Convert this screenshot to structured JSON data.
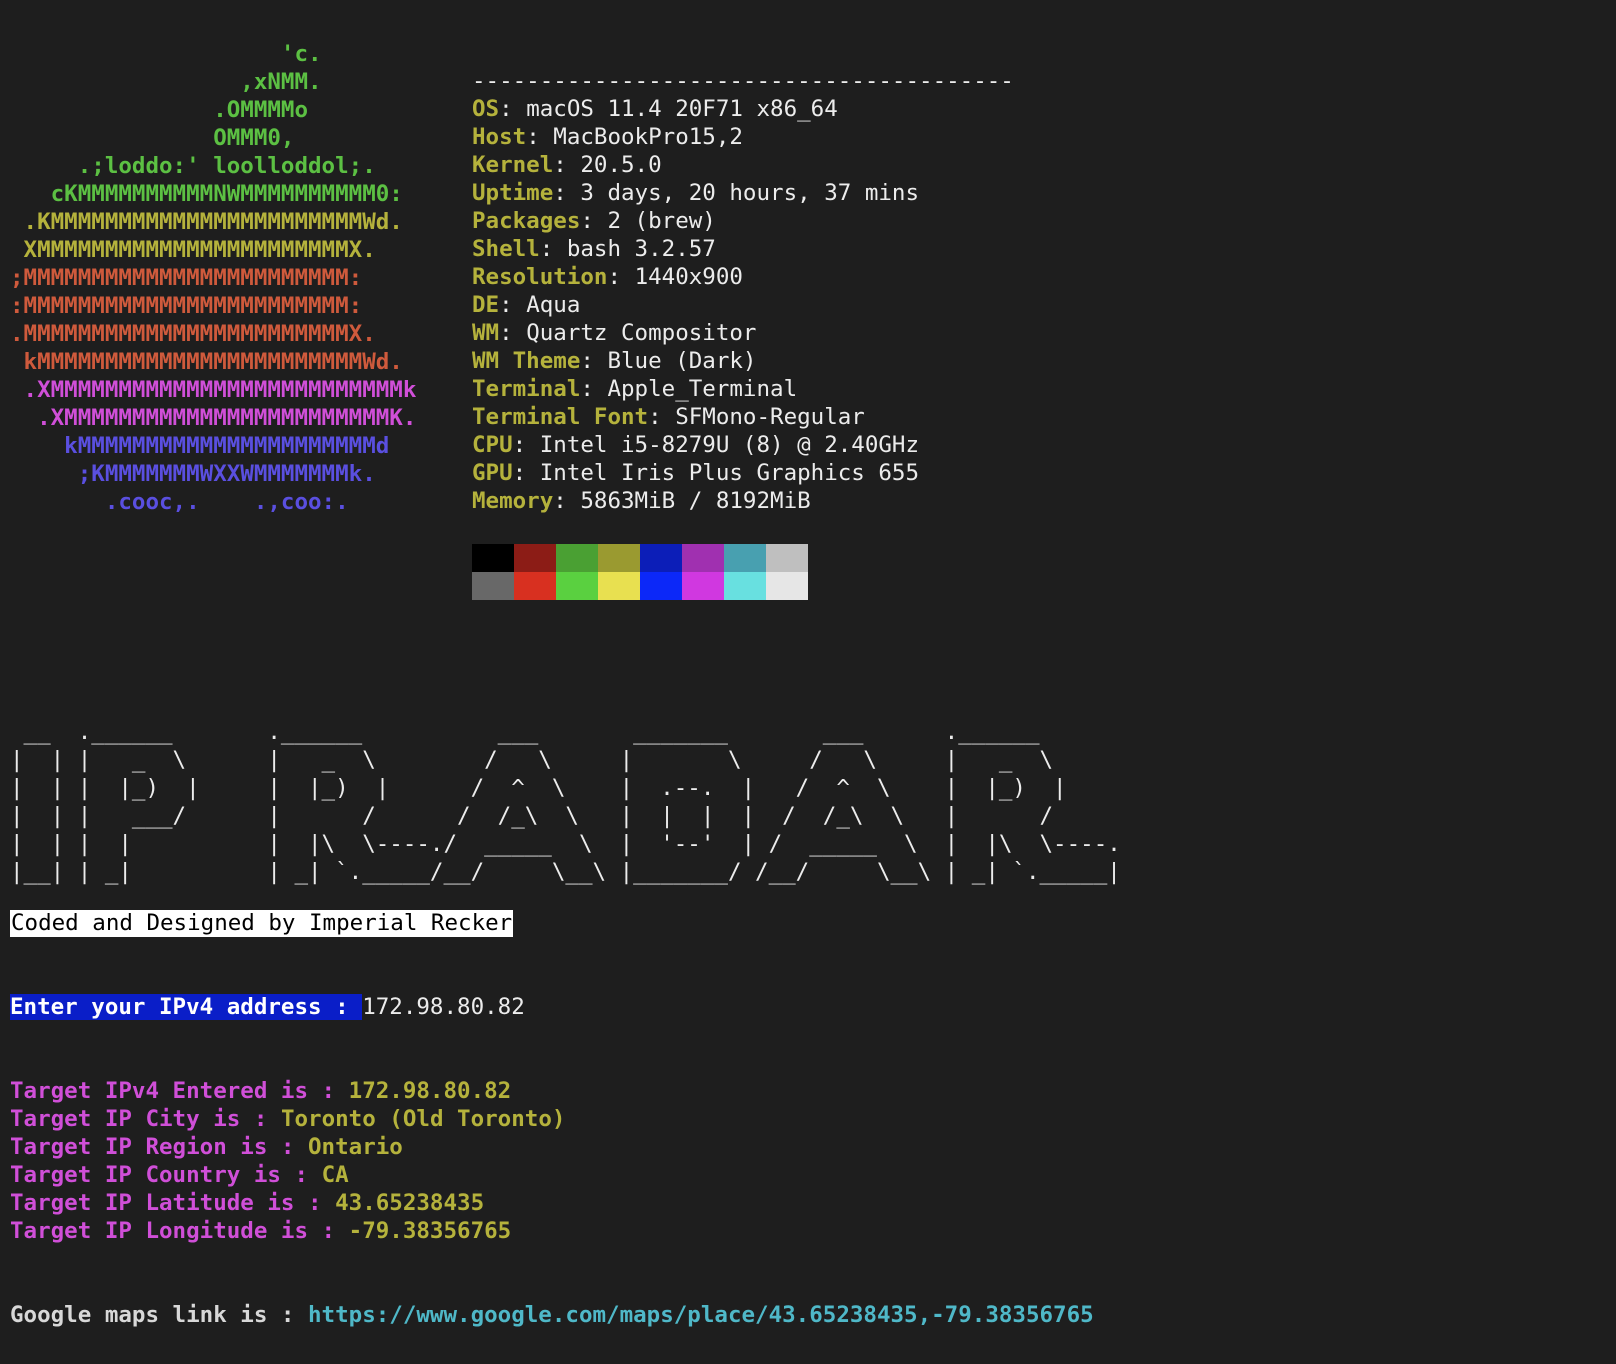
{
  "colors": {
    "background": "#1e1e1e",
    "foreground": "#ececec",
    "info_key": "#b5b23c",
    "result_label": "#d04fd8",
    "result_value": "#b5b23c",
    "maps_label": "#d8d8d8",
    "maps_link": "#4fb8c8",
    "prompt_bg": "#0a1ec8"
  },
  "logo": {
    "lines": [
      {
        "text": "                    'c.",
        "color": "#5cc043"
      },
      {
        "text": "                 ,xNMM.",
        "color": "#5cc043"
      },
      {
        "text": "               .OMMMMo",
        "color": "#5cc043"
      },
      {
        "text": "               OMMM0,",
        "color": "#5cc043"
      },
      {
        "text": "     .;loddo:' loolloddol;.",
        "color": "#5cc043"
      },
      {
        "text": "   cKMMMMMMMMMMNWMMMMMMMMMM0:",
        "color": "#5cc043"
      },
      {
        "text": " .KMMMMMMMMMMMMMMMMMMMMMMMWd.",
        "color": "#b5b23c"
      },
      {
        "text": " XMMMMMMMMMMMMMMMMMMMMMMMX.",
        "color": "#b5b23c"
      },
      {
        "text": ";MMMMMMMMMMMMMMMMMMMMMMMM:",
        "color": "#cf5a3c"
      },
      {
        "text": ":MMMMMMMMMMMMMMMMMMMMMMMM:",
        "color": "#cf5a3c"
      },
      {
        "text": ".MMMMMMMMMMMMMMMMMMMMMMMMX.",
        "color": "#cf5a3c"
      },
      {
        "text": " kMMMMMMMMMMMMMMMMMMMMMMMMWd.",
        "color": "#cf5a3c"
      },
      {
        "text": " .XMMMMMMMMMMMMMMMMMMMMMMMMMMk",
        "color": "#d04fd8"
      },
      {
        "text": "  .XMMMMMMMMMMMMMMMMMMMMMMMMK.",
        "color": "#d04fd8"
      },
      {
        "text": "    kMMMMMMMMMMMMMMMMMMMMMMd",
        "color": "#5a4fe0"
      },
      {
        "text": "     ;KMMMMMMMWXXWMMMMMMMk.",
        "color": "#5a4fe0"
      },
      {
        "text": "       .cooc,.    .,coo:.",
        "color": "#5a4fe0"
      }
    ]
  },
  "info": {
    "separator": "----------------------------------------",
    "rows": [
      {
        "key": "OS",
        "value": "macOS 11.4 20F71 x86_64"
      },
      {
        "key": "Host",
        "value": "MacBookPro15,2"
      },
      {
        "key": "Kernel",
        "value": "20.5.0"
      },
      {
        "key": "Uptime",
        "value": "3 days, 20 hours, 37 mins"
      },
      {
        "key": "Packages",
        "value": "2 (brew)"
      },
      {
        "key": "Shell",
        "value": "bash 3.2.57"
      },
      {
        "key": "Resolution",
        "value": "1440x900"
      },
      {
        "key": "DE",
        "value": "Aqua"
      },
      {
        "key": "WM",
        "value": "Quartz Compositor"
      },
      {
        "key": "WM Theme",
        "value": "Blue (Dark)"
      },
      {
        "key": "Terminal",
        "value": "Apple_Terminal"
      },
      {
        "key": "Terminal Font",
        "value": "SFMono-Regular"
      },
      {
        "key": "CPU",
        "value": "Intel i5-8279U (8) @ 2.40GHz"
      },
      {
        "key": "GPU",
        "value": "Intel Iris Plus Graphics 655"
      },
      {
        "key": "Memory",
        "value": "5863MiB / 8192MiB"
      }
    ],
    "palette_top": [
      "#000000",
      "#8c1c16",
      "#4aa033",
      "#9a9a30",
      "#0c1eb8",
      "#a030b0",
      "#48a0b0",
      "#bfbfbf"
    ],
    "palette_bottom": [
      "#686868",
      "#d83020",
      "#5ad040",
      "#e8e050",
      "#0c28f8",
      "#d038e0",
      "#68e0e0",
      "#e6e6e6"
    ]
  },
  "banner": {
    "lines": [
      " __  .______       .______          ___       _______       ___      .______",
      "|  | |   _  \\      |   _  \\        /   \\     |       \\     /   \\     |   _  \\",
      "|  | |  |_)  |     |  |_)  |      /  ^  \\    |  .--.  |   /  ^  \\    |  |_)  |",
      "|  | |   ___/      |      /      /  /_\\  \\   |  |  |  |  /  /_\\  \\   |      /",
      "|  | |  |          |  |\\  \\----./  _____  \\  |  '--'  | /  _____  \\  |  |\\  \\----.",
      "|__| | _|          | _| `._____/__/     \\__\\ |_______/ /__/     \\__\\ | _| `._____|"
    ]
  },
  "credit": "Coded and Designed by Imperial Recker",
  "prompt": {
    "label": "Enter your IPv4 address : ",
    "value": "172.98.80.82"
  },
  "results": [
    {
      "label": "Target IPv4 Entered is : ",
      "value": "172.98.80.82"
    },
    {
      "label": "Target IP City is : ",
      "value": "Toronto (Old Toronto)"
    },
    {
      "label": "Target IP Region is : ",
      "value": "Ontario"
    },
    {
      "label": "Target IP Country is : ",
      "value": "CA"
    },
    {
      "label": "Target IP Latitude is : ",
      "value": "43.65238435"
    },
    {
      "label": "Target IP Longitude is : ",
      "value": "-79.38356765"
    }
  ],
  "maps": {
    "label": "Google maps link is : ",
    "link": "https://www.google.com/maps/place/43.65238435,-79.38356765"
  }
}
